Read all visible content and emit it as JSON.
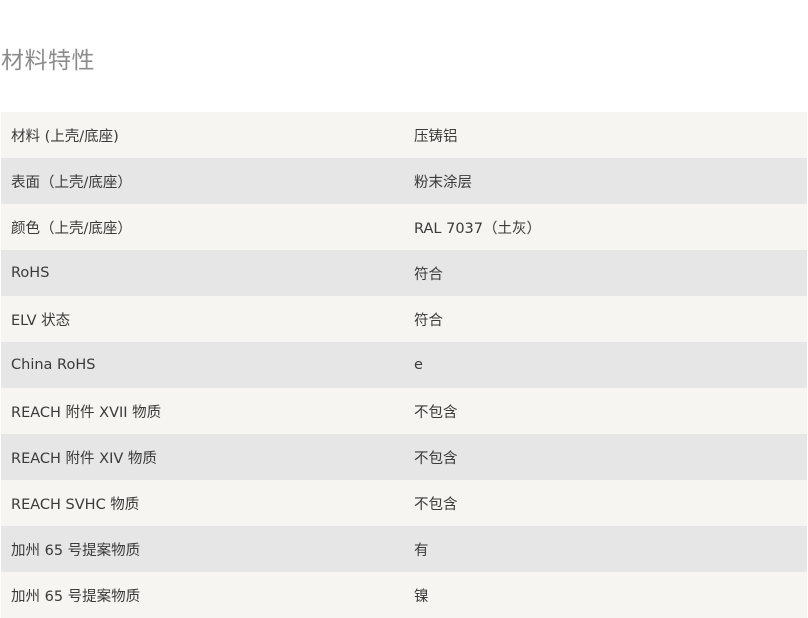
{
  "section": {
    "title": "材料特性"
  },
  "rows": [
    {
      "label": "材料 (上壳/底座)",
      "value": "压铸铝"
    },
    {
      "label": "表面（上壳/底座）",
      "value": "粉末涂层"
    },
    {
      "label": "颜色（上壳/底座）",
      "value": "RAL 7037（土灰）"
    },
    {
      "label": "RoHS",
      "value": "符合"
    },
    {
      "label": "ELV 状态",
      "value": "符合"
    },
    {
      "label": "China RoHS",
      "value": "e"
    },
    {
      "label": "REACH 附件 XVII 物质",
      "value": "不包含"
    },
    {
      "label": "REACH 附件 XIV 物质",
      "value": "不包含"
    },
    {
      "label": "REACH SVHC 物质",
      "value": "不包含"
    },
    {
      "label": "加州 65 号提案物质",
      "value": "有"
    },
    {
      "label": "加州 65 号提案物质",
      "value": "镍"
    }
  ]
}
